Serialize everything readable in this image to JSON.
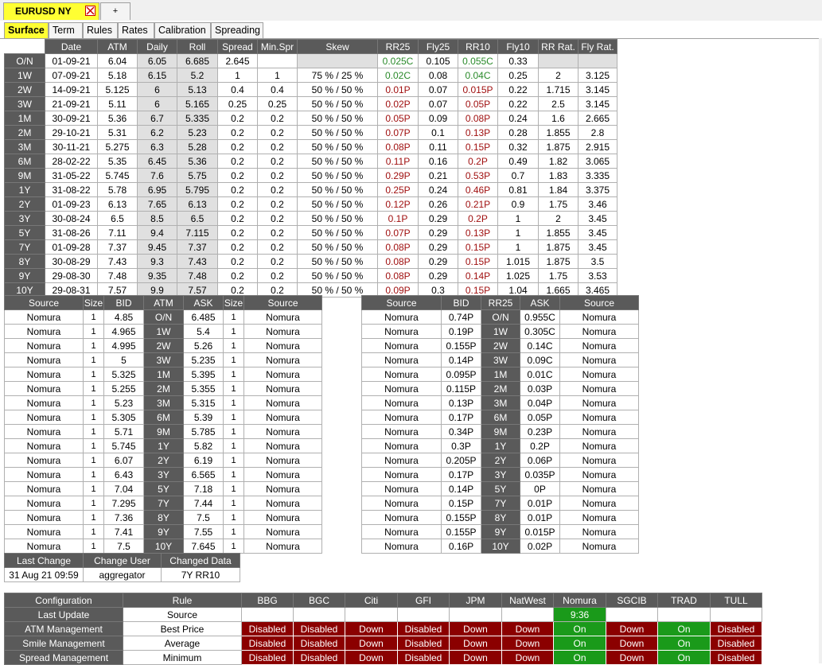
{
  "window": {
    "active_tab": "EURUSD NY",
    "plus_label": "+"
  },
  "subtabs": [
    "Surface",
    "Term",
    "Rules",
    "Rates",
    "Calibration",
    "Spreading"
  ],
  "surface": {
    "headers": [
      "",
      "Date",
      "ATM",
      "Daily",
      "Roll",
      "Spread",
      "Min.Spr",
      "Skew",
      "RR25",
      "Fly25",
      "RR10",
      "Fly10",
      "RR Rat.",
      "Fly Rat."
    ],
    "rows": [
      {
        "tenor": "O/N",
        "date": "01-09-21",
        "atm": "6.04",
        "daily": "6.05",
        "roll": "6.685",
        "spread": "2.645",
        "minspr": "",
        "skew": "",
        "rr25": "0.025C",
        "fly25": "0.105",
        "rr10": "0.055C",
        "fly10": "0.33",
        "rrrat": "",
        "flyrat": ""
      },
      {
        "tenor": "1W",
        "date": "07-09-21",
        "atm": "5.18",
        "daily": "6.15",
        "roll": "5.2",
        "spread": "1",
        "minspr": "1",
        "skew": "75 % / 25 %",
        "rr25": "0.02C",
        "fly25": "0.08",
        "rr10": "0.04C",
        "fly10": "0.25",
        "rrrat": "2",
        "flyrat": "3.125"
      },
      {
        "tenor": "2W",
        "date": "14-09-21",
        "atm": "5.125",
        "daily": "6",
        "roll": "5.13",
        "spread": "0.4",
        "minspr": "0.4",
        "skew": "50 % / 50 %",
        "rr25": "0.01P",
        "fly25": "0.07",
        "rr10": "0.015P",
        "fly10": "0.22",
        "rrrat": "1.715",
        "flyrat": "3.145"
      },
      {
        "tenor": "3W",
        "date": "21-09-21",
        "atm": "5.11",
        "daily": "6",
        "roll": "5.165",
        "spread": "0.25",
        "minspr": "0.25",
        "skew": "50 % / 50 %",
        "rr25": "0.02P",
        "fly25": "0.07",
        "rr10": "0.05P",
        "fly10": "0.22",
        "rrrat": "2.5",
        "flyrat": "3.145"
      },
      {
        "tenor": "1M",
        "date": "30-09-21",
        "atm": "5.36",
        "daily": "6.7",
        "roll": "5.335",
        "spread": "0.2",
        "minspr": "0.2",
        "skew": "50 % / 50 %",
        "rr25": "0.05P",
        "fly25": "0.09",
        "rr10": "0.08P",
        "fly10": "0.24",
        "rrrat": "1.6",
        "flyrat": "2.665"
      },
      {
        "tenor": "2M",
        "date": "29-10-21",
        "atm": "5.31",
        "daily": "6.2",
        "roll": "5.23",
        "spread": "0.2",
        "minspr": "0.2",
        "skew": "50 % / 50 %",
        "rr25": "0.07P",
        "fly25": "0.1",
        "rr10": "0.13P",
        "fly10": "0.28",
        "rrrat": "1.855",
        "flyrat": "2.8"
      },
      {
        "tenor": "3M",
        "date": "30-11-21",
        "atm": "5.275",
        "daily": "6.3",
        "roll": "5.28",
        "spread": "0.2",
        "minspr": "0.2",
        "skew": "50 % / 50 %",
        "rr25": "0.08P",
        "fly25": "0.11",
        "rr10": "0.15P",
        "fly10": "0.32",
        "rrrat": "1.875",
        "flyrat": "2.915"
      },
      {
        "tenor": "6M",
        "date": "28-02-22",
        "atm": "5.35",
        "daily": "6.45",
        "roll": "5.36",
        "spread": "0.2",
        "minspr": "0.2",
        "skew": "50 % / 50 %",
        "rr25": "0.11P",
        "fly25": "0.16",
        "rr10": "0.2P",
        "fly10": "0.49",
        "rrrat": "1.82",
        "flyrat": "3.065"
      },
      {
        "tenor": "9M",
        "date": "31-05-22",
        "atm": "5.745",
        "daily": "7.6",
        "roll": "5.75",
        "spread": "0.2",
        "minspr": "0.2",
        "skew": "50 % / 50 %",
        "rr25": "0.29P",
        "fly25": "0.21",
        "rr10": "0.53P",
        "fly10": "0.7",
        "rrrat": "1.83",
        "flyrat": "3.335"
      },
      {
        "tenor": "1Y",
        "date": "31-08-22",
        "atm": "5.78",
        "daily": "6.95",
        "roll": "5.795",
        "spread": "0.2",
        "minspr": "0.2",
        "skew": "50 % / 50 %",
        "rr25": "0.25P",
        "fly25": "0.24",
        "rr10": "0.46P",
        "fly10": "0.81",
        "rrrat": "1.84",
        "flyrat": "3.375"
      },
      {
        "tenor": "2Y",
        "date": "01-09-23",
        "atm": "6.13",
        "daily": "7.65",
        "roll": "6.13",
        "spread": "0.2",
        "minspr": "0.2",
        "skew": "50 % / 50 %",
        "rr25": "0.12P",
        "fly25": "0.26",
        "rr10": "0.21P",
        "fly10": "0.9",
        "rrrat": "1.75",
        "flyrat": "3.46"
      },
      {
        "tenor": "3Y",
        "date": "30-08-24",
        "atm": "6.5",
        "daily": "8.5",
        "roll": "6.5",
        "spread": "0.2",
        "minspr": "0.2",
        "skew": "50 % / 50 %",
        "rr25": "0.1P",
        "fly25": "0.29",
        "rr10": "0.2P",
        "fly10": "1",
        "rrrat": "2",
        "flyrat": "3.45"
      },
      {
        "tenor": "5Y",
        "date": "31-08-26",
        "atm": "7.11",
        "daily": "9.4",
        "roll": "7.115",
        "spread": "0.2",
        "minspr": "0.2",
        "skew": "50 % / 50 %",
        "rr25": "0.07P",
        "fly25": "0.29",
        "rr10": "0.13P",
        "fly10": "1",
        "rrrat": "1.855",
        "flyrat": "3.45"
      },
      {
        "tenor": "7Y",
        "date": "01-09-28",
        "atm": "7.37",
        "daily": "9.45",
        "roll": "7.37",
        "spread": "0.2",
        "minspr": "0.2",
        "skew": "50 % / 50 %",
        "rr25": "0.08P",
        "fly25": "0.29",
        "rr10": "0.15P",
        "fly10": "1",
        "rrrat": "1.875",
        "flyrat": "3.45"
      },
      {
        "tenor": "8Y",
        "date": "30-08-29",
        "atm": "7.43",
        "daily": "9.3",
        "roll": "7.43",
        "spread": "0.2",
        "minspr": "0.2",
        "skew": "50 % / 50 %",
        "rr25": "0.08P",
        "fly25": "0.29",
        "rr10": "0.15P",
        "fly10": "1.015",
        "rrrat": "1.875",
        "flyrat": "3.5"
      },
      {
        "tenor": "9Y",
        "date": "29-08-30",
        "atm": "7.48",
        "daily": "9.35",
        "roll": "7.48",
        "spread": "0.2",
        "minspr": "0.2",
        "skew": "50 % / 50 %",
        "rr25": "0.08P",
        "fly25": "0.29",
        "rr10": "0.14P",
        "fly10": "1.025",
        "rrrat": "1.75",
        "flyrat": "3.53"
      },
      {
        "tenor": "10Y",
        "date": "29-08-31",
        "atm": "7.57",
        "daily": "9.9",
        "roll": "7.57",
        "spread": "0.2",
        "minspr": "0.2",
        "skew": "50 % / 50 %",
        "rr25": "0.09P",
        "fly25": "0.3",
        "rr10": "0.15P",
        "fly10": "1.04",
        "rrrat": "1.665",
        "flyrat": "3.465"
      }
    ]
  },
  "atm_quotes": {
    "headers": [
      "Source",
      "Size",
      "BID",
      "ATM",
      "ASK",
      "Size",
      "Source"
    ],
    "rows": [
      [
        "Nomura",
        "1",
        "4.85",
        "O/N",
        "6.485",
        "1",
        "Nomura"
      ],
      [
        "Nomura",
        "1",
        "4.965",
        "1W",
        "5.4",
        "1",
        "Nomura"
      ],
      [
        "Nomura",
        "1",
        "4.995",
        "2W",
        "5.26",
        "1",
        "Nomura"
      ],
      [
        "Nomura",
        "1",
        "5",
        "3W",
        "5.235",
        "1",
        "Nomura"
      ],
      [
        "Nomura",
        "1",
        "5.325",
        "1M",
        "5.395",
        "1",
        "Nomura"
      ],
      [
        "Nomura",
        "1",
        "5.255",
        "2M",
        "5.355",
        "1",
        "Nomura"
      ],
      [
        "Nomura",
        "1",
        "5.23",
        "3M",
        "5.315",
        "1",
        "Nomura"
      ],
      [
        "Nomura",
        "1",
        "5.305",
        "6M",
        "5.39",
        "1",
        "Nomura"
      ],
      [
        "Nomura",
        "1",
        "5.71",
        "9M",
        "5.785",
        "1",
        "Nomura"
      ],
      [
        "Nomura",
        "1",
        "5.745",
        "1Y",
        "5.82",
        "1",
        "Nomura"
      ],
      [
        "Nomura",
        "1",
        "6.07",
        "2Y",
        "6.19",
        "1",
        "Nomura"
      ],
      [
        "Nomura",
        "1",
        "6.43",
        "3Y",
        "6.565",
        "1",
        "Nomura"
      ],
      [
        "Nomura",
        "1",
        "7.04",
        "5Y",
        "7.18",
        "1",
        "Nomura"
      ],
      [
        "Nomura",
        "1",
        "7.295",
        "7Y",
        "7.44",
        "1",
        "Nomura"
      ],
      [
        "Nomura",
        "1",
        "7.36",
        "8Y",
        "7.5",
        "1",
        "Nomura"
      ],
      [
        "Nomura",
        "1",
        "7.41",
        "9Y",
        "7.55",
        "1",
        "Nomura"
      ],
      [
        "Nomura",
        "1",
        "7.5",
        "10Y",
        "7.645",
        "1",
        "Nomura"
      ]
    ]
  },
  "rr_quotes": {
    "headers": [
      "Source",
      "BID",
      "RR25",
      "ASK",
      "Source"
    ],
    "rows": [
      [
        "Nomura",
        "0.74P",
        "O/N",
        "0.955C",
        "Nomura"
      ],
      [
        "Nomura",
        "0.19P",
        "1W",
        "0.305C",
        "Nomura"
      ],
      [
        "Nomura",
        "0.155P",
        "2W",
        "0.14C",
        "Nomura"
      ],
      [
        "Nomura",
        "0.14P",
        "3W",
        "0.09C",
        "Nomura"
      ],
      [
        "Nomura",
        "0.095P",
        "1M",
        "0.01C",
        "Nomura"
      ],
      [
        "Nomura",
        "0.115P",
        "2M",
        "0.03P",
        "Nomura"
      ],
      [
        "Nomura",
        "0.13P",
        "3M",
        "0.04P",
        "Nomura"
      ],
      [
        "Nomura",
        "0.17P",
        "6M",
        "0.05P",
        "Nomura"
      ],
      [
        "Nomura",
        "0.34P",
        "9M",
        "0.23P",
        "Nomura"
      ],
      [
        "Nomura",
        "0.3P",
        "1Y",
        "0.2P",
        "Nomura"
      ],
      [
        "Nomura",
        "0.205P",
        "2Y",
        "0.06P",
        "Nomura"
      ],
      [
        "Nomura",
        "0.17P",
        "3Y",
        "0.035P",
        "Nomura"
      ],
      [
        "Nomura",
        "0.14P",
        "5Y",
        "0P",
        "Nomura"
      ],
      [
        "Nomura",
        "0.15P",
        "7Y",
        "0.01P",
        "Nomura"
      ],
      [
        "Nomura",
        "0.155P",
        "8Y",
        "0.01P",
        "Nomura"
      ],
      [
        "Nomura",
        "0.155P",
        "9Y",
        "0.015P",
        "Nomura"
      ],
      [
        "Nomura",
        "0.16P",
        "10Y",
        "0.02P",
        "Nomura"
      ]
    ]
  },
  "change_info": {
    "headers": [
      "Last Change",
      "Change User",
      "Changed Data"
    ],
    "values": [
      "31 Aug 21 09:59",
      "aggregator",
      "7Y RR10"
    ]
  },
  "config": {
    "headers": [
      "Configuration",
      "Rule",
      "BBG",
      "BGC",
      "Citi",
      "GFI",
      "JPM",
      "NatWest",
      "Nomura",
      "SGCIB",
      "TRAD",
      "TULL"
    ],
    "last_update": {
      "label": "Last Update",
      "rule": "Source",
      "values": [
        "",
        "",
        "",
        "",
        "",
        "",
        "9:36",
        "",
        "",
        ""
      ]
    },
    "rows": [
      {
        "label": "ATM Management",
        "rule": "Best Price",
        "values": [
          "Disabled",
          "Disabled",
          "Down",
          "Disabled",
          "Down",
          "Down",
          "On",
          "Down",
          "On",
          "Disabled"
        ]
      },
      {
        "label": "Smile Management",
        "rule": "Average",
        "values": [
          "Disabled",
          "Disabled",
          "Down",
          "Disabled",
          "Down",
          "Down",
          "On",
          "Down",
          "On",
          "Disabled"
        ]
      },
      {
        "label": "Spread Management",
        "rule": "Minimum",
        "values": [
          "Disabled",
          "Disabled",
          "Down",
          "Disabled",
          "Down",
          "Down",
          "On",
          "Down",
          "On",
          "Disabled"
        ]
      }
    ]
  },
  "colors": {
    "active_tab": "#ffff33",
    "header_gray": "#5a5a5a",
    "status_red": "#8b0000",
    "status_green": "#1a9a1a",
    "positive_text": "#2a8a2a",
    "negative_text": "#a01010"
  }
}
